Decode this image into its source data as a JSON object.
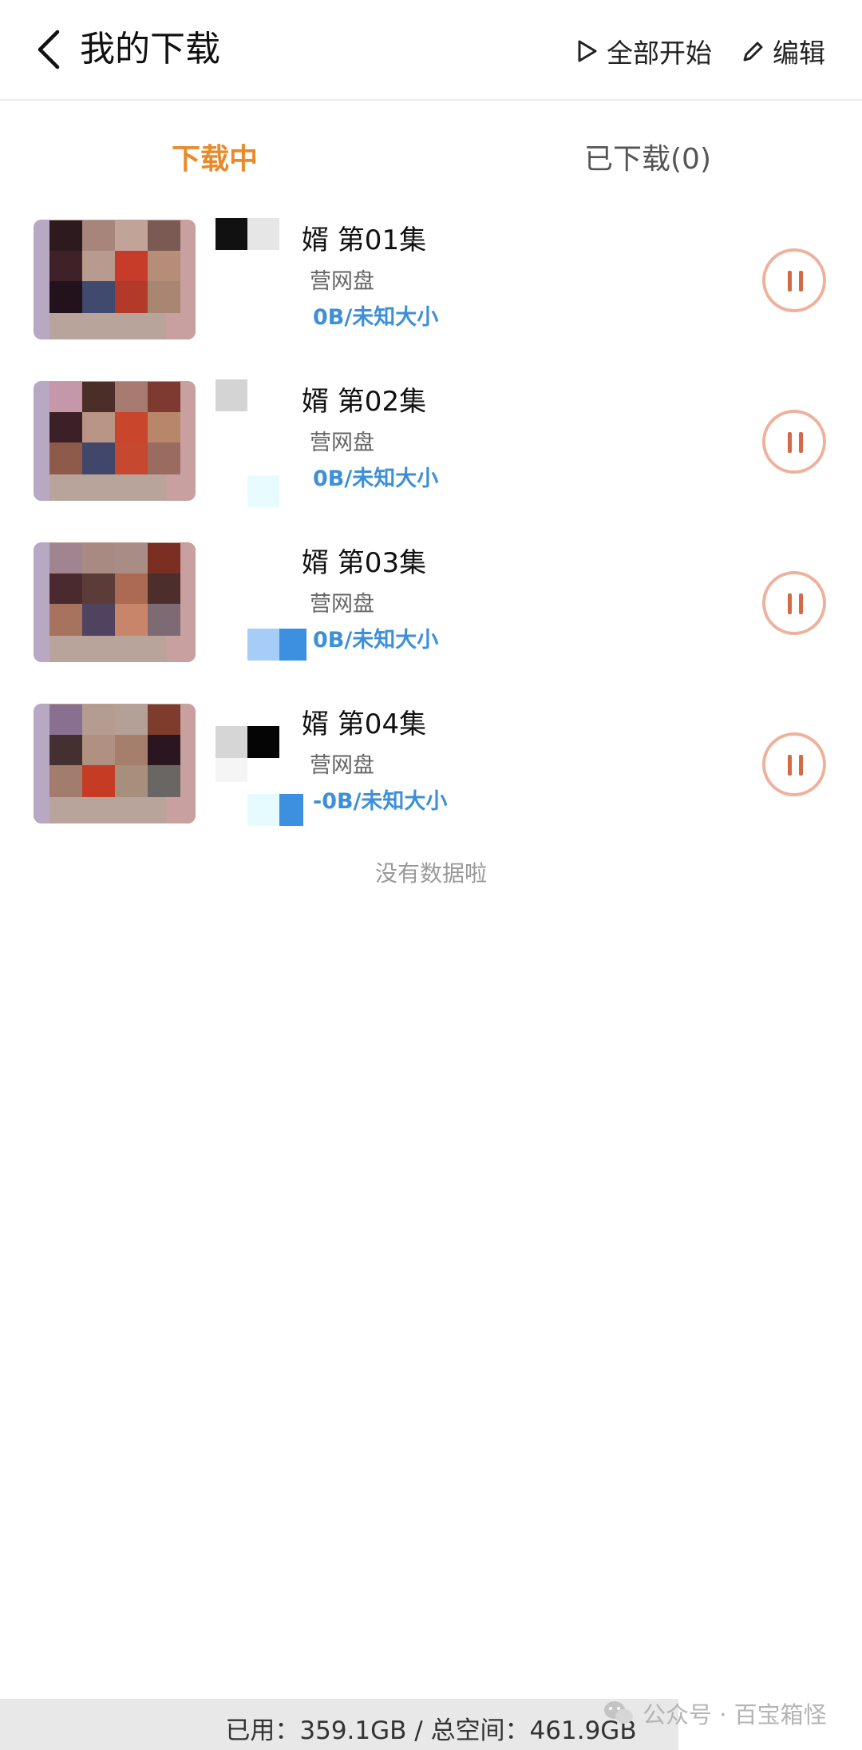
{
  "header": {
    "title": "我的下载",
    "start_all_label": "全部开始",
    "edit_label": "编辑",
    "back_icon": "chevron-left-icon",
    "start_all_icon": "play-icon",
    "edit_icon": "pencil-icon"
  },
  "tabs": [
    {
      "label": "下载中",
      "active": true
    },
    {
      "label": "已下载(0)",
      "active": false
    }
  ],
  "downloads": [
    {
      "title": "婿  第01集",
      "source": "营网盘",
      "progress": "0B/未知大小",
      "status_icon": "pause-icon"
    },
    {
      "title": "婿  第02集",
      "source": "营网盘",
      "progress": "0B/未知大小",
      "status_icon": "pause-icon"
    },
    {
      "title": "婿  第03集",
      "source": "营网盘",
      "progress": "0B/未知大小",
      "status_icon": "pause-icon"
    },
    {
      "title": "婿  第04集",
      "source": "营网盘",
      "progress": "-0B/未知大小",
      "status_icon": "pause-icon"
    }
  ],
  "empty_hint": "没有数据啦",
  "storage": {
    "text": "已用：359.1GB / 总空间：461.9GB"
  },
  "watermark": {
    "text": "公众号 · 百宝箱怪",
    "icon": "wechat-icon"
  },
  "colors": {
    "accent": "#e98a2a",
    "progress": "#3d8fd8",
    "pause_ring": "#eeb19c",
    "pause_bars": "#d36a45"
  }
}
